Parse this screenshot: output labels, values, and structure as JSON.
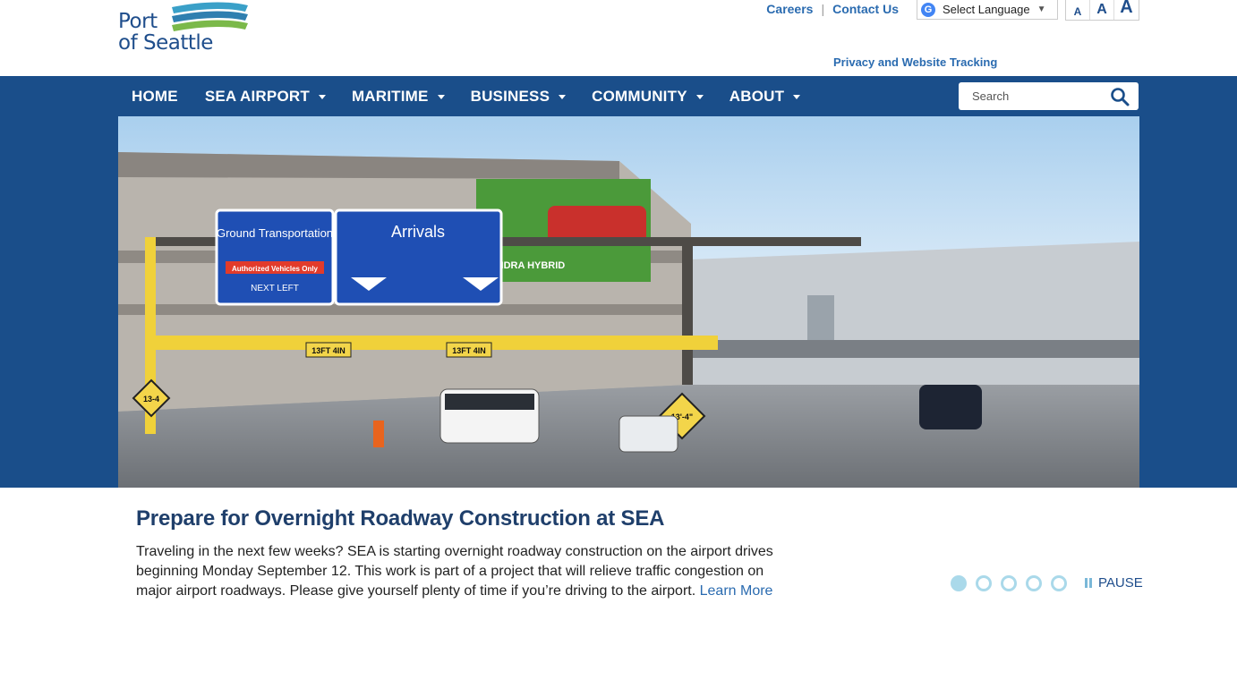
{
  "brand": {
    "logo_line1": "Port",
    "logo_line2": "of Seattle"
  },
  "utility": {
    "careers": "Careers",
    "contact": "Contact Us",
    "language_select": "Select Language",
    "font_small": "A",
    "font_medium": "A",
    "font_large": "A",
    "privacy": "Privacy and Website Tracking"
  },
  "nav": {
    "items": [
      {
        "label": "HOME"
      },
      {
        "label": "SEA AIRPORT"
      },
      {
        "label": "MARITIME"
      },
      {
        "label": "BUSINESS"
      },
      {
        "label": "COMMUNITY"
      },
      {
        "label": "ABOUT"
      }
    ],
    "search_placeholder": "Search"
  },
  "hero": {
    "signs": {
      "ground_transport": "Ground Transportation",
      "authorized": "Authorized Vehicles Only",
      "next_left": "NEXT LEFT",
      "arrivals": "Arrivals",
      "clearance1": "13FT 4IN",
      "clearance2": "13FT 4IN",
      "diamond1": "13-4",
      "diamond2": "13'-4\"",
      "billboard": "TUNDRA HYBRID"
    }
  },
  "slide": {
    "title": "Prepare for Overnight Roadway Construction at SEA",
    "body": "Traveling in the next few weeks? SEA is starting overnight roadway construction on the airport drives beginning Monday September 12. This work is part of a project that will relieve traffic congestion on major airport roadways. Please give yourself plenty of time if you’re driving to the airport.",
    "link": "Learn More",
    "dot_count": 5,
    "active_dot": 1,
    "pause_label": "PAUSE"
  },
  "colors": {
    "nav_blue": "#1a4e8a",
    "link_blue": "#2a6bb0",
    "dot_blue": "#aad9ea"
  }
}
